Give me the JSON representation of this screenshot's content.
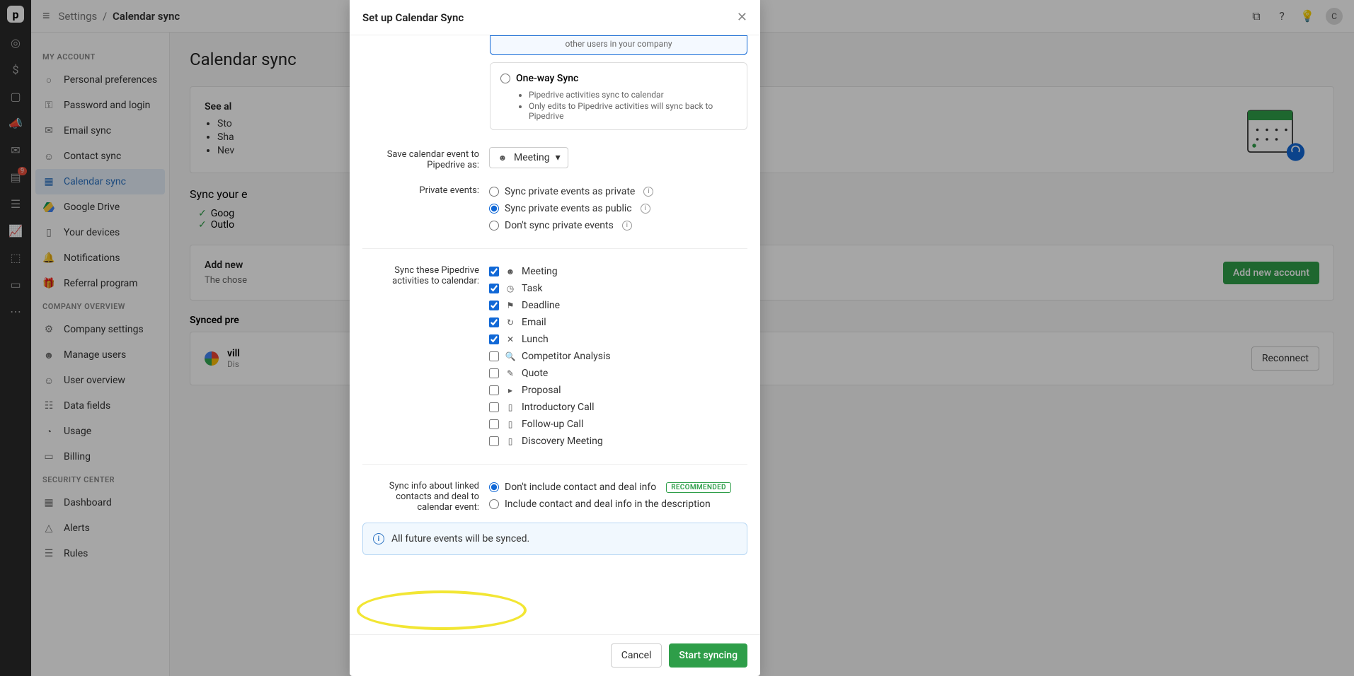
{
  "rail": {
    "logo": "p",
    "badge": "9"
  },
  "topbar": {
    "breadcrumb_root": "Settings",
    "breadcrumb_current": "Calendar sync",
    "avatar_initial": "C"
  },
  "sidebar": {
    "section_my_account": "MY ACCOUNT",
    "section_company": "COMPANY OVERVIEW",
    "section_security": "SECURITY CENTER",
    "items": {
      "personal": "Personal preferences",
      "password": "Password and login",
      "email_sync": "Email sync",
      "contact_sync": "Contact sync",
      "calendar_sync": "Calendar sync",
      "gdrive": "Google Drive",
      "devices": "Your devices",
      "notifications": "Notifications",
      "referral": "Referral program",
      "company_settings": "Company settings",
      "manage_users": "Manage users",
      "user_overview": "User overview",
      "data_fields": "Data fields",
      "usage": "Usage",
      "billing": "Billing",
      "dashboard": "Dashboard",
      "alerts": "Alerts",
      "rules": "Rules"
    }
  },
  "page": {
    "title": "Calendar sync",
    "card1_head": "See al",
    "card1_b1": "Sto",
    "card1_b2": "Sha",
    "card1_b3": "Nev",
    "sync_external": "Sync your e",
    "ext1": "Goog",
    "ext2": "Outlo",
    "add_head": "Add new",
    "add_sub": "The chose",
    "add_btn": "Add new account",
    "synced_head": "Synced pre",
    "acct_name": "vill",
    "acct_status": "Dis",
    "reconnect": "Reconnect"
  },
  "modal": {
    "title": "Set up Calendar Sync",
    "selected_sync_note": "other users in your company",
    "oneway_title": "One-way Sync",
    "oneway_b1": "Pipedrive activities sync to calendar",
    "oneway_b2": "Only edits to Pipedrive activities will sync back to Pipedrive",
    "save_as_label": "Save calendar event to Pipedrive as:",
    "save_as_value": "Meeting",
    "private_label": "Private events:",
    "private_opt1": "Sync private events as private",
    "private_opt2": "Sync private events as public",
    "private_opt3": "Don't sync private events",
    "activities_label": "Sync these Pipedrive activities to calendar:",
    "acts": [
      {
        "label": "Meeting",
        "checked": true,
        "icon": "people"
      },
      {
        "label": "Task",
        "checked": true,
        "icon": "clock"
      },
      {
        "label": "Deadline",
        "checked": true,
        "icon": "flag"
      },
      {
        "label": "Email",
        "checked": true,
        "icon": "mail"
      },
      {
        "label": "Lunch",
        "checked": true,
        "icon": "fork"
      },
      {
        "label": "Competitor Analysis",
        "checked": false,
        "icon": "lens"
      },
      {
        "label": "Quote",
        "checked": false,
        "icon": "pencil"
      },
      {
        "label": "Proposal",
        "checked": false,
        "icon": "doc"
      },
      {
        "label": "Introductory Call",
        "checked": false,
        "icon": "phone"
      },
      {
        "label": "Follow-up Call",
        "checked": false,
        "icon": "phone"
      },
      {
        "label": "Discovery Meeting",
        "checked": false,
        "icon": "phone"
      }
    ],
    "linked_label": "Sync info about linked contacts and deal to calendar event:",
    "linked_opt1": "Don't include contact and deal info",
    "linked_reco": "RECOMMENDED",
    "linked_opt2": "Include contact and deal info in the description",
    "banner": "All future events will be synced.",
    "cancel": "Cancel",
    "start": "Start syncing"
  }
}
